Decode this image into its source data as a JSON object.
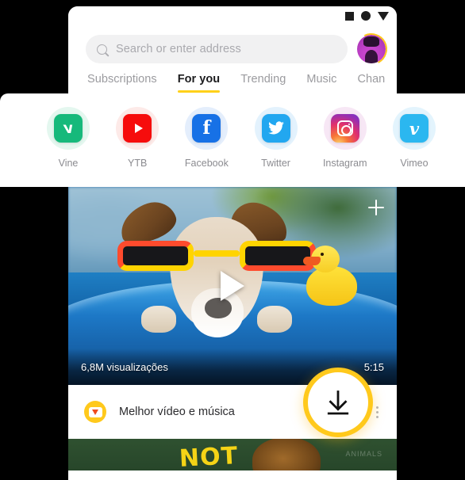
{
  "statusbar": {
    "icons": [
      "square-icon",
      "circle-icon",
      "triangle-down-icon"
    ]
  },
  "search": {
    "placeholder": "Search or enter address",
    "icon": "search-icon",
    "value": ""
  },
  "account": {
    "avatar": "user-avatar",
    "ring_color": "#ffc61a"
  },
  "tabs": [
    {
      "label": "Subscriptions",
      "active": false
    },
    {
      "label": "For you",
      "active": true
    },
    {
      "label": "Trending",
      "active": false
    },
    {
      "label": "Music",
      "active": false
    },
    {
      "label": "Chan",
      "active": false
    }
  ],
  "tab_indicator_color": "#ffd11a",
  "apps": [
    {
      "label": "Vine",
      "icon": "vine-icon",
      "color": "#16b97b",
      "halo": "#e4f7ef"
    },
    {
      "label": "YTB",
      "icon": "youtube-icon",
      "color": "#f60c0c",
      "halo": "#fdeae8"
    },
    {
      "label": "Facebook",
      "icon": "facebook-icon",
      "color": "#1771e6",
      "halo": "#e4eefc"
    },
    {
      "label": "Twitter",
      "icon": "twitter-icon",
      "color": "#22a7f0",
      "halo": "#e3f2fd"
    },
    {
      "label": "Instagram",
      "icon": "instagram-icon",
      "color": "#c32aa3",
      "halo": "#f7e7f5"
    },
    {
      "label": "Vimeo",
      "icon": "vimeo-icon",
      "color": "#2bb7f0",
      "halo": "#e3f4fd"
    }
  ],
  "feed": {
    "video": {
      "thumbnail_alt": "dog-with-sunglasses-in-pool",
      "views": "6,8M visualizações",
      "duration": "5:15",
      "title": "Melhor vídeo e música",
      "add_icon": "plus-icon",
      "play_icon": "play-icon",
      "download_badge_icon": "download-badge-icon",
      "menu_icon": "kebab-menu-icon"
    },
    "next_video": {
      "thumbnail_alt": "lion-green-poster",
      "overlay_text": "NOT",
      "faint_text": "ANIMALS"
    }
  },
  "fab": {
    "icon": "download-icon",
    "accent": "#ffc91c",
    "label": "Download"
  }
}
